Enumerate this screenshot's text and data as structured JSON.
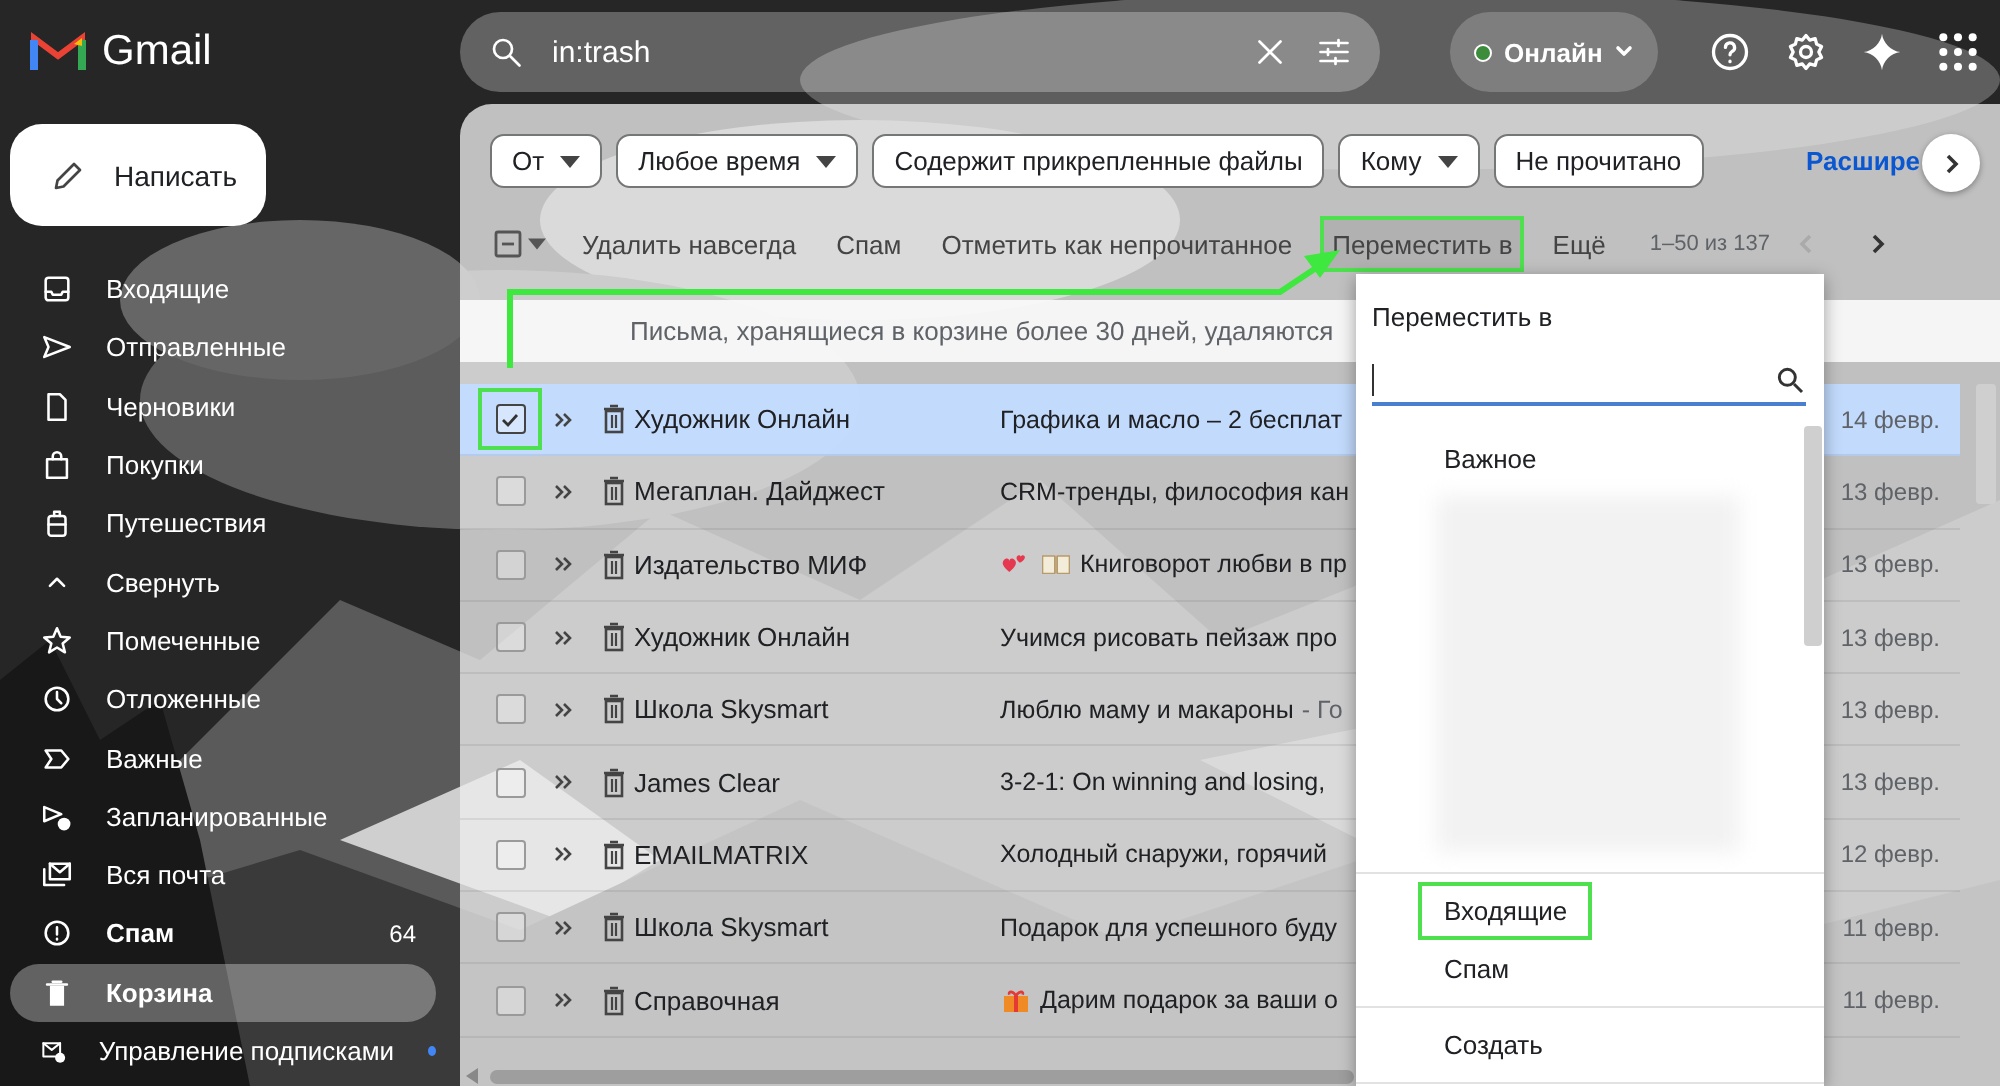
{
  "header": {
    "logo": "Gmail",
    "search": {
      "value": "in:trash"
    },
    "status": "Онлайн"
  },
  "compose": "Написать",
  "sidebar": {
    "items": [
      {
        "label": "Входящие",
        "selected": false,
        "unread": false,
        "new_dot": false
      },
      {
        "label": "Отправленные",
        "selected": false,
        "unread": false,
        "new_dot": false
      },
      {
        "label": "Черновики",
        "selected": false,
        "unread": false,
        "new_dot": false
      },
      {
        "label": "Покупки",
        "selected": false,
        "unread": false,
        "new_dot": false
      },
      {
        "label": "Путешествия",
        "selected": false,
        "unread": false,
        "new_dot": false
      },
      {
        "label": "Свернуть",
        "selected": false,
        "unread": false,
        "new_dot": false
      },
      {
        "label": "Помеченные",
        "selected": false,
        "unread": false,
        "new_dot": false
      },
      {
        "label": "Отложенные",
        "selected": false,
        "unread": false,
        "new_dot": false
      },
      {
        "label": "Важные",
        "selected": false,
        "unread": false,
        "new_dot": false
      },
      {
        "label": "Запланированные",
        "selected": false,
        "unread": false,
        "new_dot": false
      },
      {
        "label": "Вся почта",
        "selected": false,
        "unread": false,
        "new_dot": false
      },
      {
        "label": "Спам",
        "count": "64",
        "selected": false,
        "unread": true,
        "new_dot": false
      },
      {
        "label": "Корзина",
        "selected": true,
        "unread": false,
        "new_dot": false
      },
      {
        "label": "Управление подписками",
        "selected": false,
        "unread": false,
        "new_dot": true
      }
    ]
  },
  "filters": {
    "chips": [
      {
        "label": "От",
        "dropdown": true
      },
      {
        "label": "Любое время",
        "dropdown": true
      },
      {
        "label": "Содержит прикрепленные файлы",
        "dropdown": false
      },
      {
        "label": "Кому",
        "dropdown": true
      },
      {
        "label": "Не прочитано",
        "dropdown": false
      }
    ],
    "link": "Расшире"
  },
  "toolbar": {
    "actions": [
      {
        "label": "Удалить навсегда",
        "highlighted": false
      },
      {
        "label": "Спам",
        "highlighted": false
      },
      {
        "label": "Отметить как непрочитанное",
        "highlighted": false
      },
      {
        "label": "Переместить в",
        "highlighted": true
      },
      {
        "label": "Ещё",
        "highlighted": false
      }
    ],
    "pagination": "1–50 из 137"
  },
  "notice": "Письма, хранящиеся в корзине более 30 дней, удаляются",
  "rows": [
    {
      "checked": true,
      "selected": true,
      "checkbox_highlighted": true,
      "sender": "Художник Онлайн",
      "subject": "Графика и масло – 2 бесплат",
      "date": "14 февр."
    },
    {
      "checked": false,
      "selected": false,
      "checkbox_highlighted": false,
      "sender": "Мегаплан. Дайджест",
      "subject": "CRM-тренды, философия кан",
      "date": "13 февр."
    },
    {
      "checked": false,
      "selected": false,
      "checkbox_highlighted": false,
      "sender": "Издательство МИФ",
      "prefix_icons": [
        {
          "kind": "hearts"
        },
        {
          "kind": "book"
        }
      ],
      "subject": "Книговорот любви в пр",
      "date": "13 февр."
    },
    {
      "checked": false,
      "selected": false,
      "checkbox_highlighted": false,
      "sender": "Художник Онлайн",
      "subject": "Учимся рисовать пейзаж про",
      "date": "13 февр."
    },
    {
      "checked": false,
      "selected": false,
      "checkbox_highlighted": false,
      "sender": "Школа Skysmart",
      "subject": "Люблю маму и макароны",
      "snippet": "- Го",
      "date": "13 февр."
    },
    {
      "checked": false,
      "selected": false,
      "checkbox_highlighted": false,
      "sender": "James Clear",
      "subject": "3-2-1: On winning and losing,",
      "date": "13 февр."
    },
    {
      "checked": false,
      "selected": false,
      "checkbox_highlighted": false,
      "sender": "EMAILMATRIX",
      "subject": "Холодный снаружи, горячий",
      "date": "12 февр."
    },
    {
      "checked": false,
      "selected": false,
      "checkbox_highlighted": false,
      "sender": "Школа Skysmart",
      "subject": "Подарок для успешного буду",
      "date": "11 февр."
    },
    {
      "checked": false,
      "selected": false,
      "checkbox_highlighted": false,
      "sender": "Справочная",
      "prefix_icons": [
        {
          "kind": "gift"
        }
      ],
      "subject": "Дарим подарок за ваши о",
      "date": "11 февр."
    }
  ],
  "menu": {
    "title": "Переместить в",
    "groups": [
      {
        "items": [
          {
            "kind": "label",
            "label": "Важное",
            "highlighted": false
          },
          {
            "kind": "blurred"
          }
        ]
      },
      {
        "items": [
          {
            "kind": "label",
            "label": "Входящие",
            "highlighted": true
          },
          {
            "kind": "label",
            "label": "Спам",
            "highlighted": false
          }
        ]
      },
      {
        "items": [
          {
            "kind": "label",
            "label": "Создать",
            "highlighted": false
          }
        ]
      }
    ]
  }
}
